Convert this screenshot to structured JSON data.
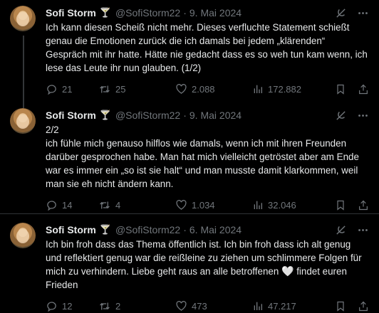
{
  "tweets": [
    {
      "name": "Sofi Storm",
      "emoji": "🍸",
      "handle": "@SofiStorm22",
      "date": "9. Mai 2024",
      "text": "Ich kann diesen Scheiß nicht mehr. Dieses verfluchte  Statement schießt genau die Emotionen zurück die ich damals bei jedem „klärenden“ Gespräch mit ihr hatte. Hätte nie gedacht dass es so weh tun kam wenn, ich lese das Leute ihr nun glauben. (1/2)",
      "replies": "21",
      "reposts": "25",
      "likes": "2.088",
      "views": "172.882"
    },
    {
      "name": "Sofi Storm",
      "emoji": "🍸",
      "handle": "@SofiStorm22",
      "date": "9. Mai 2024",
      "text": "2/2\nich fühle mich genauso hilflos wie damals, wenn ich mit ihren Freunden darüber gesprochen habe. Man hat mich vielleicht getröstet aber am Ende war es immer ein „so ist sie halt“ und man musste damit klarkommen, weil man sie eh nicht ändern kann.",
      "replies": "14",
      "reposts": "4",
      "likes": "1.034",
      "views": "32.046"
    },
    {
      "name": "Sofi Storm",
      "emoji": "🍸",
      "handle": "@SofiStorm22",
      "date": "6. Mai 2024",
      "text": "Ich bin froh dass das Thema öffentlich ist. Ich bin froh dass ich alt genug und reflektiert genug war die reißleine zu ziehen um schlimmere Folgen für mich zu verhindern. Liebe geht raus an alle betroffenen",
      "text_heart": "🤍",
      "text_after": " findet euren Frieden",
      "replies": "12",
      "reposts": "2",
      "likes": "473",
      "views": "47.217"
    }
  ],
  "icons": {
    "grok": "grok-icon",
    "more": "more-icon",
    "reply": "reply-icon",
    "repost": "repost-icon",
    "like": "like-icon",
    "views": "views-icon",
    "bookmark": "bookmark-icon",
    "share": "share-icon"
  },
  "colors": {
    "background": "#000000",
    "text": "#e7e9ea",
    "muted": "#71767b",
    "divider": "#2f3336"
  }
}
